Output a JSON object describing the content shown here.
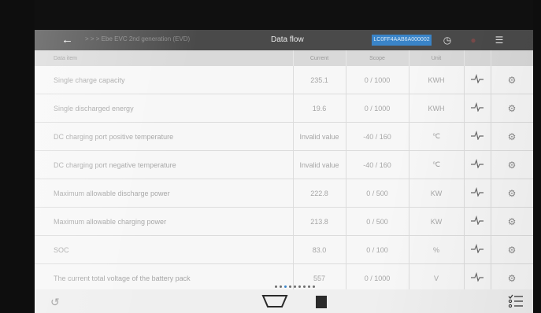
{
  "header": {
    "back_icon": "arrow-left-icon",
    "breadcrumb": "> > > Ebe EVC 2nd generation (EVD)",
    "title": "Data flow",
    "vin": "LC0FF4AAB6A000002",
    "icons": [
      "clock-icon",
      "record-icon",
      "menu-icon"
    ]
  },
  "table": {
    "columns": [
      "Data item",
      "Current",
      "Scope",
      "Unit"
    ],
    "rows": [
      {
        "name": "Single charge capacity",
        "current": "235.1",
        "scope": "0 / 1000",
        "unit": "KWH"
      },
      {
        "name": "Single discharged energy",
        "current": "19.6",
        "scope": "0 / 1000",
        "unit": "KWH"
      },
      {
        "name": "DC charging port positive temperature",
        "current": "Invalid value",
        "scope": "-40 / 160",
        "unit": "℃"
      },
      {
        "name": "DC charging port negative temperature",
        "current": "Invalid value",
        "scope": "-40 / 160",
        "unit": "℃"
      },
      {
        "name": "Maximum allowable discharge power",
        "current": "222.8",
        "scope": "0 / 500",
        "unit": "KW"
      },
      {
        "name": "Maximum allowable charging power",
        "current": "213.8",
        "scope": "0 / 500",
        "unit": "KW"
      },
      {
        "name": "SOC",
        "current": "83.0",
        "scope": "0 / 100",
        "unit": "%"
      },
      {
        "name": "The current total voltage of the battery pack",
        "current": "557",
        "scope": "0 / 1000",
        "unit": "V"
      }
    ]
  },
  "pager": {
    "pages": 9,
    "current": 3
  },
  "footer": {
    "icons": [
      "back-arc-icon",
      "trapezoid-icon",
      "stop-square-icon",
      "checklist-icon"
    ]
  }
}
